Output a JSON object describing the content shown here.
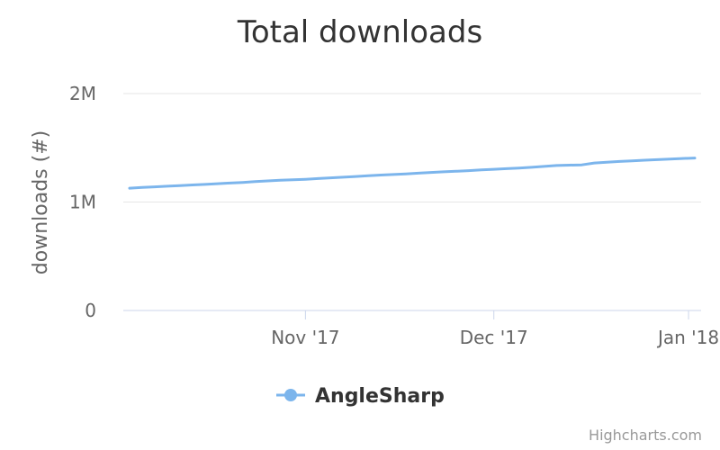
{
  "chart_data": {
    "type": "line",
    "title": "Total downloads",
    "ylabel": "downloads (#)",
    "xlabel": "",
    "ylim": [
      0,
      2000000
    ],
    "yticks": [
      {
        "value": 0,
        "label": "0"
      },
      {
        "value": 1000000,
        "label": "1M"
      },
      {
        "value": 2000000,
        "label": "2M"
      }
    ],
    "xlim": [
      "2017-10-03",
      "2018-01-03"
    ],
    "xticks": [
      {
        "value": "2017-11-01",
        "label": "Nov '17"
      },
      {
        "value": "2017-12-01",
        "label": "Dec '17"
      },
      {
        "value": "2018-01-01",
        "label": "Jan '18"
      }
    ],
    "grid": true,
    "legend_position": "bottom-center",
    "series": [
      {
        "name": "AngleSharp",
        "color": "#7cb5ec",
        "x": [
          "2017-10-04",
          "2017-10-06",
          "2017-10-08",
          "2017-10-10",
          "2017-10-12",
          "2017-10-14",
          "2017-10-16",
          "2017-10-18",
          "2017-10-20",
          "2017-10-22",
          "2017-10-24",
          "2017-10-26",
          "2017-10-28",
          "2017-10-30",
          "2017-11-01",
          "2017-11-03",
          "2017-11-05",
          "2017-11-07",
          "2017-11-09",
          "2017-11-11",
          "2017-11-13",
          "2017-11-15",
          "2017-11-17",
          "2017-11-19",
          "2017-11-21",
          "2017-11-23",
          "2017-11-25",
          "2017-11-27",
          "2017-11-29",
          "2017-12-01",
          "2017-12-03",
          "2017-12-05",
          "2017-12-07",
          "2017-12-09",
          "2017-12-11",
          "2017-12-13",
          "2017-12-15",
          "2017-12-17",
          "2017-12-19",
          "2017-12-21",
          "2017-12-23",
          "2017-12-25",
          "2017-12-27",
          "2017-12-29",
          "2017-12-31",
          "2018-01-02"
        ],
        "values": [
          1128000,
          1135000,
          1140000,
          1146000,
          1151000,
          1158000,
          1163000,
          1169000,
          1175000,
          1181000,
          1188000,
          1195000,
          1201000,
          1205000,
          1210000,
          1217000,
          1223000,
          1229000,
          1236000,
          1243000,
          1249000,
          1254000,
          1260000,
          1266000,
          1273000,
          1279000,
          1284000,
          1290000,
          1296000,
          1302000,
          1308000,
          1314000,
          1320000,
          1329000,
          1337000,
          1340000,
          1343000,
          1360000,
          1368000,
          1374000,
          1380000,
          1386000,
          1391000,
          1396000,
          1402000,
          1406000
        ]
      }
    ],
    "credits": "Highcharts.com"
  }
}
